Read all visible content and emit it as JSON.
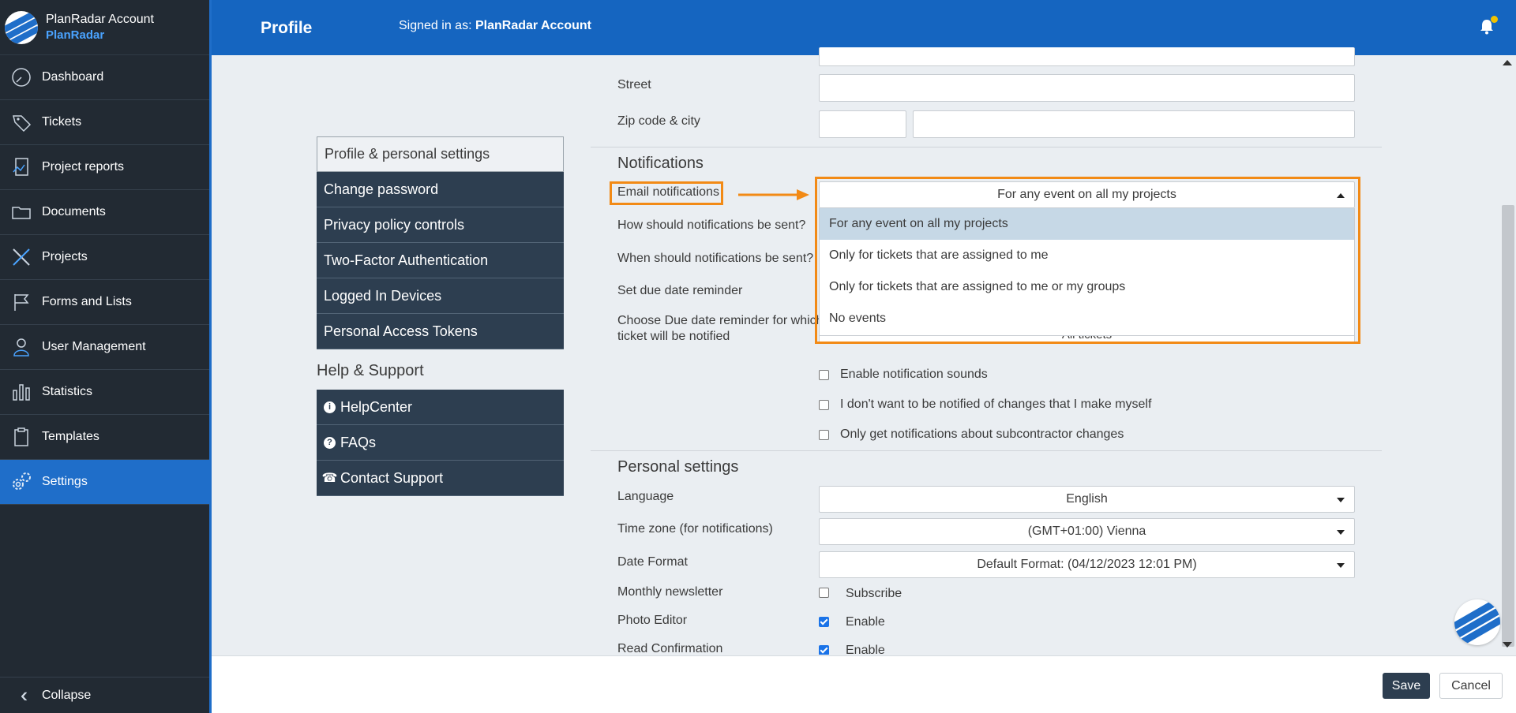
{
  "account": {
    "name": "PlanRadar Account",
    "org": "PlanRadar"
  },
  "sidebar": {
    "items": [
      {
        "label": "Dashboard",
        "icon": "dashboard-gauge-icon"
      },
      {
        "label": "Tickets",
        "icon": "ticket-tag-icon"
      },
      {
        "label": "Project reports",
        "icon": "report-icon"
      },
      {
        "label": "Documents",
        "icon": "folder-icon"
      },
      {
        "label": "Projects",
        "icon": "tools-icon"
      },
      {
        "label": "Forms and Lists",
        "icon": "flag-icon"
      },
      {
        "label": "User Management",
        "icon": "user-icon"
      },
      {
        "label": "Statistics",
        "icon": "bar-chart-icon"
      },
      {
        "label": "Templates",
        "icon": "clipboard-icon"
      },
      {
        "label": "Settings",
        "icon": "gears-icon"
      }
    ],
    "collapse": "Collapse"
  },
  "topbar": {
    "title": "Profile",
    "signed_prefix": "Signed in as:",
    "signed_user": "PlanRadar Account"
  },
  "settings_menu": [
    "Profile & personal settings",
    "Change password",
    "Privacy policy controls",
    "Two-Factor Authentication",
    "Logged In Devices",
    "Personal Access Tokens"
  ],
  "help": {
    "title": "Help & Support",
    "items": [
      {
        "label": "HelpCenter",
        "glyph": "i"
      },
      {
        "label": "FAQs",
        "glyph": "?"
      },
      {
        "label": "Contact Support",
        "glyph": "☎"
      }
    ]
  },
  "form": {
    "street_label": "Street",
    "zip_label": "Zip code & city",
    "notifications_title": "Notifications",
    "email_label": "Email notifications",
    "email_value": "For any event on all my projects",
    "email_options": [
      "For any event on all my projects",
      "Only for tickets that are assigned to me",
      "Only for tickets that are assigned to me or my groups",
      "No events"
    ],
    "how_label": "How should notifications be sent?",
    "when_label": "When should notifications be sent?",
    "due_label": "Set due date reminder",
    "choose_due_label_1": "Choose Due date reminder for which",
    "choose_due_label_2": "ticket will be notified",
    "choose_due_value": "All tickets",
    "checks": [
      {
        "label": "Enable notification sounds",
        "checked": false
      },
      {
        "label": "I don't want to be notified of changes that I make myself",
        "checked": false
      },
      {
        "label": "Only get notifications about subcontractor changes",
        "checked": false
      }
    ],
    "personal_title": "Personal settings",
    "language_label": "Language",
    "language_value": "English",
    "timezone_label": "Time zone (for notifications)",
    "timezone_value": "(GMT+01:00) Vienna",
    "dateformat_label": "Date Format",
    "dateformat_value": "Default Format: (04/12/2023 12:01 PM)",
    "newsletter_label": "Monthly newsletter",
    "newsletter_value": "Subscribe",
    "photo_label": "Photo Editor",
    "photo_value": "Enable",
    "read_label": "Read Confirmation",
    "read_value": "Enable"
  },
  "footer": {
    "save": "Save",
    "cancel": "Cancel"
  },
  "colors": {
    "sidebar": "#222a33",
    "brand_blue": "#1565c0",
    "active_nav": "#1f6ec9",
    "menu_dark": "#2d3e50",
    "highlight": "#f28a16",
    "selected_option": "#c6d8e6"
  }
}
